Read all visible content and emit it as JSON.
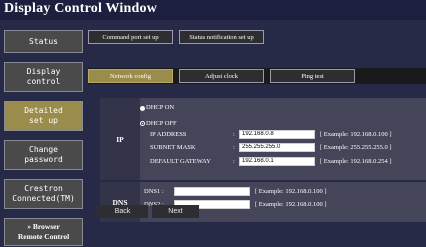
{
  "window": {
    "title": "Display Control Window"
  },
  "sidebar": {
    "items": [
      {
        "label": "Status"
      },
      {
        "label": "Display\ncontrol"
      },
      {
        "label": "Detailed\nset up"
      },
      {
        "label": "Change\npassword"
      },
      {
        "label": "Crestron\nConnected(TM)"
      },
      {
        "label": "» Browser\nRemote Control"
      }
    ]
  },
  "tabs": {
    "row1": [
      {
        "label": "Command port set up"
      },
      {
        "label": "Status notification set up"
      }
    ],
    "row2": [
      {
        "label": "Network config"
      },
      {
        "label": "Adjust clock"
      },
      {
        "label": "Ping test"
      }
    ]
  },
  "ip": {
    "header": "IP",
    "dhcp_on": "DHCP ON",
    "dhcp_off": "DHCP OFF",
    "selected": "DHCP ON",
    "fields": [
      {
        "label": "IP ADDRESS",
        "value": "192.168.0.8",
        "example": "[ Example: 192.168.0.100 ]"
      },
      {
        "label": "SUBNET MASK",
        "value": "255.255.255.0",
        "example": "[ Example: 255.255.255.0 ]"
      },
      {
        "label": "DEFAULT GATEWAY",
        "value": "192.168.0.1",
        "example": "[ Example: 192.168.0.254 ]"
      }
    ]
  },
  "dns": {
    "header": "DNS",
    "fields": [
      {
        "label": "DNS1 :",
        "value": "",
        "example": "[ Example: 192.168.0.100 ]"
      },
      {
        "label": "DNS2 :",
        "value": "",
        "example": "[ Example: 192.168.0.100 ]"
      }
    ]
  },
  "buttons": {
    "back": "Back",
    "next": "Next"
  },
  "colors": {
    "accent": "#9a8c4a",
    "background": "#262a46",
    "titlebar": "#1c1f3d"
  }
}
